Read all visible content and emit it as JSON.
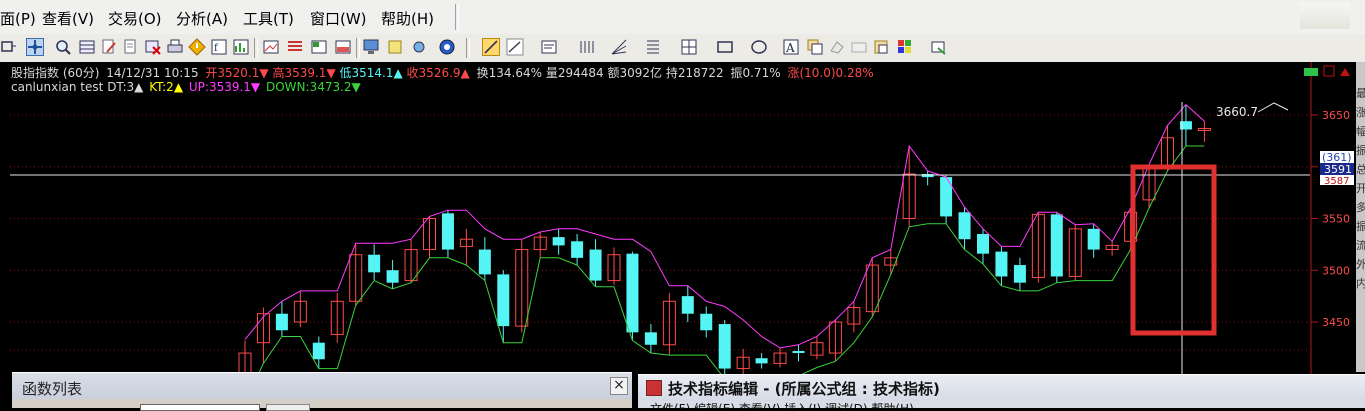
{
  "menu": [
    "面(P)",
    "查看(V)",
    "交易(O)",
    "分析(A)",
    "工具(T)",
    "窗口(W)",
    "帮助(H)"
  ],
  "info": {
    "name": "股指指数 (60分)",
    "date": "14/12/31 10:15",
    "open": "开3520.1▼",
    "high": "高3539.1▼",
    "low": "低3514.1▲",
    "close": "收3526.9▲",
    "turnover": "换134.64%",
    "volume": "量294484",
    "amount": "额3092亿",
    "hold": "持218722",
    "amplitude": "振0.71%",
    "change": "涨(10.0)0.28%"
  },
  "indicator": {
    "name": "canlunxian test",
    "dt": "DT:3▲",
    "kt": "KT:2▲",
    "up": "UP:3539.1▼",
    "down": "DOWN:3473.2▼"
  },
  "price_axis": {
    "ticks": [
      "3650",
      "3600",
      "3550",
      "3500",
      "3450"
    ],
    "labels": [
      "(361)",
      "3591",
      "3587"
    ],
    "peak": "3660.7",
    "side_chars": [
      "最",
      "涨",
      "幅",
      "振",
      "总",
      "开",
      "多",
      "振",
      "流",
      "外",
      "内"
    ]
  },
  "colors": {
    "up": "#ff4b4b",
    "down": "#56f5f5",
    "upper": "#ff3cff",
    "lower": "#3cd23c"
  },
  "func_panel": {
    "title": "函数列表",
    "close": "×"
  },
  "editor": {
    "title": "技术指标编辑 - (所属公式组 : 技术指标)",
    "menu_peek": "文件(F)   编辑(E)   查看(V)   插入(I)   调试(D)   帮助(H)"
  },
  "chart_data": {
    "type": "candlestick",
    "candles": [
      {
        "o": 3376,
        "c": 3420,
        "h": 3432,
        "l": 3372
      },
      {
        "o": 3430,
        "c": 3458,
        "h": 3464,
        "l": 3410
      },
      {
        "o": 3458,
        "c": 3442,
        "h": 3470,
        "l": 3436
      },
      {
        "o": 3450,
        "c": 3470,
        "h": 3480,
        "l": 3445
      },
      {
        "o": 3430,
        "c": 3414,
        "h": 3436,
        "l": 3405
      },
      {
        "o": 3438,
        "c": 3470,
        "h": 3478,
        "l": 3430
      },
      {
        "o": 3470,
        "c": 3515,
        "h": 3526,
        "l": 3466
      },
      {
        "o": 3515,
        "c": 3498,
        "h": 3525,
        "l": 3490
      },
      {
        "o": 3500,
        "c": 3488,
        "h": 3510,
        "l": 3482
      },
      {
        "o": 3490,
        "c": 3520,
        "h": 3530,
        "l": 3488
      },
      {
        "o": 3520,
        "c": 3550,
        "h": 3552,
        "l": 3512
      },
      {
        "o": 3555,
        "c": 3520,
        "h": 3558,
        "l": 3512
      },
      {
        "o": 3523,
        "c": 3530,
        "h": 3540,
        "l": 3505
      },
      {
        "o": 3520,
        "c": 3496,
        "h": 3532,
        "l": 3490
      },
      {
        "o": 3496,
        "c": 3446,
        "h": 3500,
        "l": 3430
      },
      {
        "o": 3446,
        "c": 3520,
        "h": 3530,
        "l": 3440
      },
      {
        "o": 3520,
        "c": 3532,
        "h": 3537,
        "l": 3512
      },
      {
        "o": 3532,
        "c": 3524,
        "h": 3540,
        "l": 3515
      },
      {
        "o": 3528,
        "c": 3512,
        "h": 3535,
        "l": 3505
      },
      {
        "o": 3520,
        "c": 3490,
        "h": 3530,
        "l": 3484
      },
      {
        "o": 3490,
        "c": 3515,
        "h": 3522,
        "l": 3486
      },
      {
        "o": 3516,
        "c": 3440,
        "h": 3518,
        "l": 3432
      },
      {
        "o": 3440,
        "c": 3428,
        "h": 3448,
        "l": 3420
      },
      {
        "o": 3428,
        "c": 3470,
        "h": 3478,
        "l": 3418
      },
      {
        "o": 3475,
        "c": 3458,
        "h": 3485,
        "l": 3450
      },
      {
        "o": 3458,
        "c": 3442,
        "h": 3465,
        "l": 3435
      },
      {
        "o": 3448,
        "c": 3405,
        "h": 3452,
        "l": 3395
      },
      {
        "o": 3405,
        "c": 3416,
        "h": 3424,
        "l": 3398
      },
      {
        "o": 3415,
        "c": 3410,
        "h": 3420,
        "l": 3405
      },
      {
        "o": 3410,
        "c": 3420,
        "h": 3425,
        "l": 3406
      },
      {
        "o": 3422,
        "c": 3420,
        "h": 3428,
        "l": 3412
      },
      {
        "o": 3418,
        "c": 3430,
        "h": 3436,
        "l": 3414
      },
      {
        "o": 3420,
        "c": 3450,
        "h": 3452,
        "l": 3412
      },
      {
        "o": 3448,
        "c": 3464,
        "h": 3470,
        "l": 3440
      },
      {
        "o": 3460,
        "c": 3505,
        "h": 3512,
        "l": 3455
      },
      {
        "o": 3505,
        "c": 3512,
        "h": 3520,
        "l": 3496
      },
      {
        "o": 3550,
        "c": 3593,
        "h": 3620,
        "l": 3542
      },
      {
        "o": 3593,
        "c": 3590,
        "h": 3596,
        "l": 3582
      },
      {
        "o": 3590,
        "c": 3552,
        "h": 3592,
        "l": 3545
      },
      {
        "o": 3556,
        "c": 3530,
        "h": 3561,
        "l": 3520
      },
      {
        "o": 3535,
        "c": 3516,
        "h": 3540,
        "l": 3506
      },
      {
        "o": 3518,
        "c": 3494,
        "h": 3523,
        "l": 3485
      },
      {
        "o": 3505,
        "c": 3488,
        "h": 3512,
        "l": 3480
      },
      {
        "o": 3493,
        "c": 3554,
        "h": 3556,
        "l": 3488
      },
      {
        "o": 3554,
        "c": 3494,
        "h": 3556,
        "l": 3488
      },
      {
        "o": 3494,
        "c": 3540,
        "h": 3544,
        "l": 3490
      },
      {
        "o": 3540,
        "c": 3520,
        "h": 3545,
        "l": 3512
      },
      {
        "o": 3520,
        "c": 3524,
        "h": 3528,
        "l": 3514
      },
      {
        "o": 3528,
        "c": 3556,
        "h": 3560,
        "l": 3520
      },
      {
        "o": 3568,
        "c": 3600,
        "h": 3602,
        "l": 3560
      },
      {
        "o": 3600,
        "c": 3628,
        "h": 3640,
        "l": 3596
      },
      {
        "o": 3644,
        "c": 3636,
        "h": 3660,
        "l": 3620
      },
      {
        "o": 3636,
        "c": 3637,
        "h": 3644,
        "l": 3624
      }
    ],
    "upper": [
      3433,
      3455,
      3470,
      3480,
      3480,
      3480,
      3526,
      3526,
      3526,
      3530,
      3552,
      3558,
      3558,
      3540,
      3530,
      3530,
      3537,
      3540,
      3540,
      3535,
      3530,
      3530,
      3518,
      3485,
      3485,
      3470,
      3465,
      3452,
      3436,
      3425,
      3428,
      3436,
      3452,
      3470,
      3512,
      3520,
      3620,
      3596,
      3590,
      3561,
      3540,
      3523,
      3523,
      3556,
      3556,
      3544,
      3545,
      3528,
      3560,
      3602,
      3640,
      3660,
      3644
    ],
    "lower": [
      3372,
      3410,
      3436,
      3436,
      3405,
      3405,
      3466,
      3490,
      3482,
      3488,
      3512,
      3512,
      3505,
      3490,
      3430,
      3430,
      3512,
      3512,
      3505,
      3484,
      3484,
      3432,
      3420,
      3418,
      3418,
      3418,
      3395,
      3395,
      3395,
      3398,
      3398,
      3406,
      3412,
      3430,
      3455,
      3496,
      3542,
      3545,
      3545,
      3520,
      3506,
      3485,
      3480,
      3480,
      3488,
      3490,
      3490,
      3490,
      3520,
      3560,
      3596,
      3620,
      3620
    ],
    "ylim": [
      3400,
      3675
    ]
  }
}
